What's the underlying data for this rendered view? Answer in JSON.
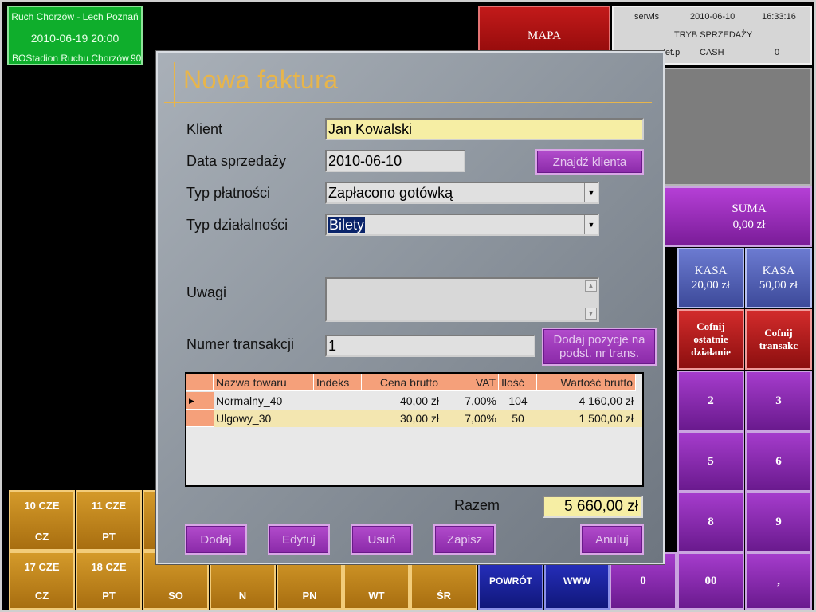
{
  "event": {
    "name": "Ruch Chorzów - Lech Poznań",
    "date": "2010-06-19   20:00",
    "venue": "BOStadion Ruchu Chorzów",
    "venue_num": "90"
  },
  "top": {
    "mapa_label": "MAPA",
    "status": {
      "user": "serwis",
      "date": "2010-06-10",
      "time": "16:33:16",
      "mode": "TRYB SPRZEDAŻY",
      "site": "ilet.pl",
      "payment": "CASH",
      "count": "0"
    }
  },
  "keypad": {
    "suma_label": "SUMA",
    "suma_value": "0,00 zł",
    "kasa": [
      {
        "label": "KASA",
        "value": "20,00 zł"
      },
      {
        "label": "KASA",
        "value": "50,00 zł"
      }
    ],
    "cofnij_last": "Cofnij ostatnie działanie",
    "cofnij_trans": "Cofnij transakc",
    "digits": [
      "2",
      "3",
      "5",
      "6",
      "8",
      "9",
      "0",
      "00",
      ","
    ],
    "powrot": "POWRÓT",
    "www": "WWW"
  },
  "calendar": [
    {
      "day": "10 CZE",
      "wd": "CZ"
    },
    {
      "day": "11 CZE",
      "wd": "PT"
    },
    {
      "day": "17 CZE",
      "wd": "CZ"
    },
    {
      "day": "18 CZE",
      "wd": "PT"
    },
    {
      "day": "",
      "wd": "SO"
    },
    {
      "day": "",
      "wd": "N"
    },
    {
      "day": "",
      "wd": "PN"
    },
    {
      "day": "",
      "wd": "WT"
    },
    {
      "day": "",
      "wd": "ŚR"
    }
  ],
  "dialog": {
    "title": "Nowa faktura",
    "client_label": "Klient",
    "client_value": "Jan Kowalski",
    "sale_date_label": "Data sprzedaży",
    "sale_date_value": "2010-06-10",
    "find_client_btn": "Znajdź klienta",
    "payment_type_label": "Typ płatności",
    "payment_type_value": "Zapłacono gotówką",
    "activity_type_label": "Typ działalności",
    "activity_type_value": "Bilety",
    "notes_label": "Uwagi",
    "notes_value": "",
    "trans_num_label": "Numer transakcji",
    "trans_num_value": "1",
    "add_pos_btn": "Dodaj pozycje na podst. nr trans.",
    "grid": {
      "columns": [
        "Nazwa towaru",
        "Indeks",
        "Cena brutto",
        "VAT",
        "Ilość",
        "Wartość brutto"
      ],
      "rows": [
        {
          "name": "Normalny_40",
          "index": "",
          "price": "40,00 zł",
          "vat": "7,00%",
          "qty": "104",
          "value": "4 160,00 zł"
        },
        {
          "name": "Ulgowy_30",
          "index": "",
          "price": "30,00 zł",
          "vat": "7,00%",
          "qty": "50",
          "value": "1 500,00 zł"
        }
      ]
    },
    "total_label": "Razem",
    "total_value": "5 660,00 zł",
    "buttons": {
      "add": "Dodaj",
      "edit": "Edytuj",
      "delete": "Usuń",
      "save": "Zapisz",
      "cancel": "Anuluj"
    }
  }
}
